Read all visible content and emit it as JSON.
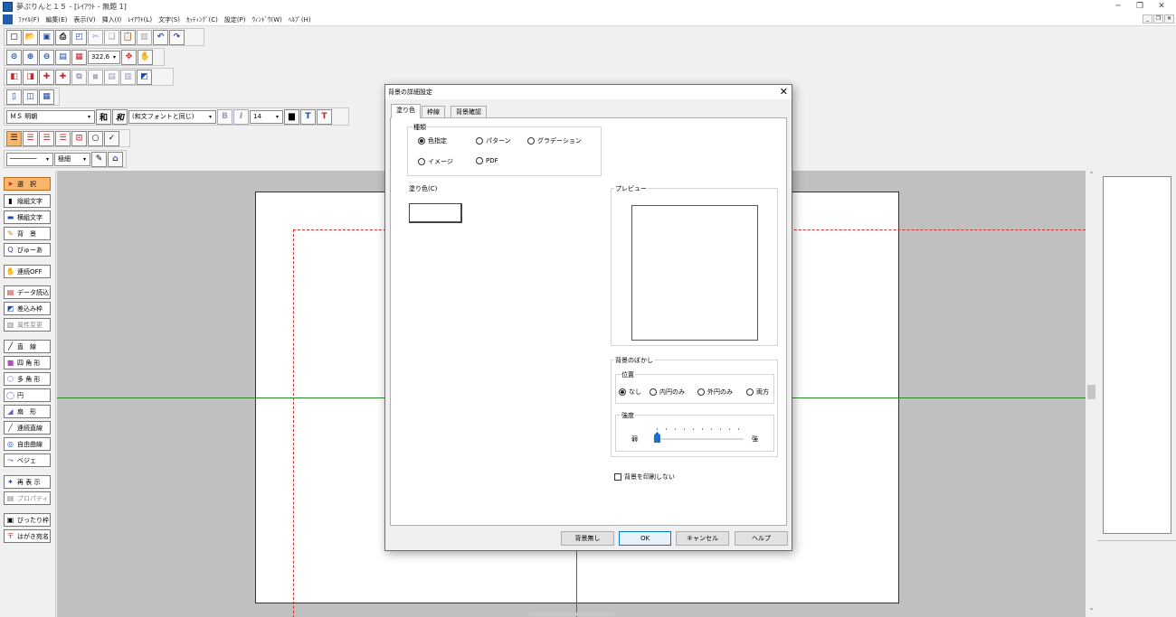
{
  "window": {
    "title": "夢ぷりんと１５ - [ﾚｲｱｳﾄ - 無題 1]"
  },
  "menu": [
    "ﾌｧｲﾙ(F)",
    "編集(E)",
    "表示(V)",
    "挿入(I)",
    "ﾚｲｱｳﾄ(L)",
    "文字(S)",
    "ｶｯﾃｨﾝｸﾞ(C)",
    "設定(P)",
    "ｳｨﾝﾄﾞｳ(W)",
    "ﾍﾙﾌﾟ(H)"
  ],
  "toolbar": {
    "zoom": "322.6",
    "font_name": "ＭＳ 明朝",
    "font_sub": "(和文フォントと同じ)",
    "font_size": "14",
    "line_weight": "極細",
    "wa_label": "和",
    "bold_label": "B",
    "italic_label": "I",
    "t_label": "T"
  },
  "palette": [
    {
      "label": "選　択",
      "icon": "arrow-icon"
    },
    {
      "label": "縦組文字",
      "icon": "vertical-text-icon"
    },
    {
      "label": "横組文字",
      "icon": "horizontal-text-icon"
    },
    {
      "label": "背　景",
      "icon": "background-icon"
    },
    {
      "label": "ぴゅーあ",
      "icon": "pure-icon"
    },
    {
      "label": "連続OFF",
      "icon": "continuous-icon"
    },
    {
      "label": "データ読込",
      "icon": "data-load-icon"
    },
    {
      "label": "差込み枠",
      "icon": "insert-frame-icon"
    },
    {
      "label": "属性変更",
      "icon": "attribute-icon"
    },
    {
      "label": "直　線",
      "icon": "line-icon"
    },
    {
      "label": "四 角 形",
      "icon": "rectangle-icon"
    },
    {
      "label": "多 角 形",
      "icon": "polygon-icon"
    },
    {
      "label": "円",
      "icon": "circle-icon"
    },
    {
      "label": "扇　形",
      "icon": "sector-icon"
    },
    {
      "label": "連続直線",
      "icon": "polyline-icon"
    },
    {
      "label": "自由曲線",
      "icon": "freecurve-icon"
    },
    {
      "label": "ベジェ",
      "icon": "bezier-icon"
    },
    {
      "label": "再 表 示",
      "icon": "redraw-icon"
    },
    {
      "label": "プロパティ",
      "icon": "property-icon"
    },
    {
      "label": "ぴったり枠",
      "icon": "fit-frame-icon"
    },
    {
      "label": "はがき宛名",
      "icon": "postcard-icon"
    }
  ],
  "dialog": {
    "title": "背景の詳細設定",
    "close": "✕",
    "tabs": [
      "塗り色",
      "枠線",
      "背景確認"
    ],
    "type_group": "種類",
    "types": [
      "色指定",
      "パターン",
      "グラデーション",
      "イメージ",
      "PDF"
    ],
    "selected_type": "色指定",
    "fill_color_label": "塗り色(C)",
    "preview_label": "プレビュー",
    "blur_group": "背景のぼかし",
    "position_group": "位置",
    "positions": [
      "なし",
      "内円のみ",
      "外円のみ",
      "両方"
    ],
    "selected_position": "なし",
    "strength_group": "強度",
    "weak": "弱",
    "strong": "強",
    "strength": 0,
    "no_print_label": "背景を印刷しない",
    "buttons": {
      "no_bg": "背景無し",
      "ok": "OK",
      "cancel": "キャンセル",
      "help": "ヘルプ"
    }
  }
}
